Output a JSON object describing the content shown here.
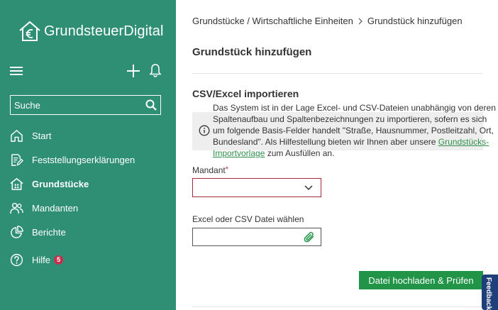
{
  "app": {
    "name": "GrundsteuerDigital"
  },
  "sidebar": {
    "search": {
      "placeholder": "Suche"
    },
    "items": [
      {
        "label": "Start",
        "icon": "home-icon"
      },
      {
        "label": "Feststellungserklärungen",
        "icon": "document-edit-icon"
      },
      {
        "label": "Grundstücke",
        "icon": "property-icon",
        "active": true
      },
      {
        "label": "Mandanten",
        "icon": "users-icon"
      },
      {
        "label": "Berichte",
        "icon": "pie-chart-icon"
      },
      {
        "label": "Hilfe",
        "icon": "help-icon",
        "badge": "5"
      }
    ]
  },
  "breadcrumb": {
    "items": [
      "Grundstücke / Wirtschaftliche Einheiten",
      "Grundstück hinzufügen"
    ]
  },
  "page": {
    "title": "Grundstück hinzufügen",
    "section_title": "CSV/Excel importieren",
    "info": {
      "text_before": "Das System ist in der Lage Excel- und CSV-Dateien unabhängig von deren Spaltenaufbau und Spaltenbezeichnungen zu importieren, sofern es sich um folgende Basis-Felder handelt \"Straße, Hausnummer, Postleitzahl, Ort, Bundesland\". Als Hilfestellung bieten wir Ihnen aber unsere ",
      "link": "Grundstücks-Importvorlage",
      "text_after": " zum Ausfüllen an."
    },
    "mandant": {
      "label": "Mandant",
      "required_mark": "*",
      "value": ""
    },
    "file": {
      "label": "Excel oder CSV Datei wählen",
      "value": ""
    },
    "upload_button": "Datei hochladen & Prüfen"
  },
  "feedback": {
    "label": "Feedback"
  },
  "colors": {
    "sidebar_bg": "#2f8f74",
    "primary_button": "#219447",
    "link": "#2f8f4a",
    "error_border": "#a52a3c",
    "badge": "#c7304d",
    "feedback_bg": "#1f3f7a"
  }
}
